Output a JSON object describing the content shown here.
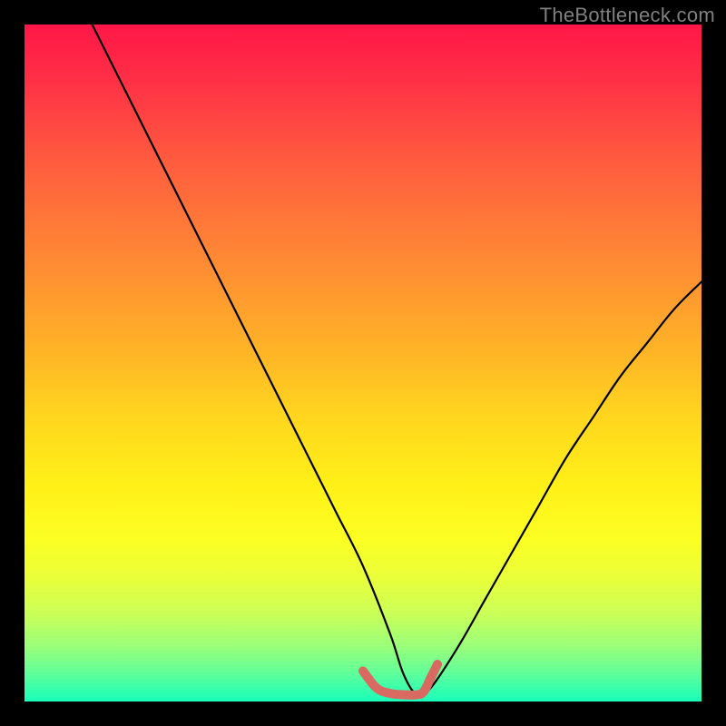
{
  "watermark": "TheBottleneck.com",
  "chart_data": {
    "type": "line",
    "title": "",
    "xlabel": "",
    "ylabel": "",
    "xlim": [
      0,
      100
    ],
    "ylim": [
      0,
      100
    ],
    "series": [
      {
        "name": "main-curve",
        "color": "#000000",
        "x": [
          10,
          14,
          18,
          22,
          26,
          30,
          34,
          38,
          42,
          46,
          50,
          54,
          56,
          58,
          60,
          64,
          68,
          72,
          76,
          80,
          84,
          88,
          92,
          96,
          100
        ],
        "y": [
          100,
          92,
          84,
          76,
          68,
          60,
          52,
          44,
          36,
          28,
          20,
          10,
          4,
          1,
          2,
          8,
          15,
          22,
          29,
          36,
          42,
          48,
          53,
          58,
          62
        ]
      },
      {
        "name": "marker-segment",
        "color": "#d96a62",
        "x": [
          50,
          52,
          54,
          56,
          58,
          59,
          60,
          61
        ],
        "y": [
          4.5,
          2.0,
          1.2,
          1.0,
          1.0,
          1.5,
          3.5,
          5.5
        ]
      }
    ],
    "gradient_stops": [
      {
        "pos": 0,
        "color": "#ff1747"
      },
      {
        "pos": 8,
        "color": "#ff2f46"
      },
      {
        "pos": 20,
        "color": "#ff5b3f"
      },
      {
        "pos": 35,
        "color": "#ff8a34"
      },
      {
        "pos": 48,
        "color": "#ffb327"
      },
      {
        "pos": 58,
        "color": "#ffd61e"
      },
      {
        "pos": 68,
        "color": "#fff018"
      },
      {
        "pos": 76,
        "color": "#fcff22"
      },
      {
        "pos": 82,
        "color": "#e8ff3a"
      },
      {
        "pos": 87,
        "color": "#caff56"
      },
      {
        "pos": 92,
        "color": "#97ff79"
      },
      {
        "pos": 96,
        "color": "#5cff9a"
      },
      {
        "pos": 100,
        "color": "#18ffb9"
      }
    ]
  }
}
